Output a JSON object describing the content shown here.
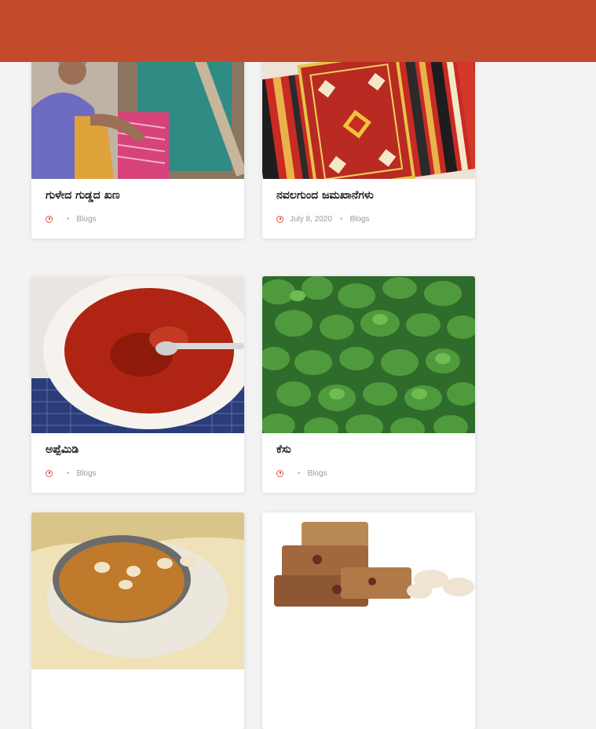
{
  "header": {
    "color": "#c44a2c"
  },
  "cards": [
    {
      "title": "ಗುಳೇದ ಗುಡ್ಡದ ಖಣ",
      "date": "",
      "category": "Blogs",
      "image": "weaver-at-handloom"
    },
    {
      "title": "ನವಲಗುಂದ ಜಮಖಾನೆಗಳು",
      "date": "July 8, 2020",
      "category": "Blogs",
      "image": "navalgund-carpet"
    },
    {
      "title": "ಅಪ್ಪೆಮಿಡಿ",
      "date": "",
      "category": "Blogs",
      "image": "mango-pickle-bowl"
    },
    {
      "title": "ಕೆಸು",
      "date": "",
      "category": "Blogs",
      "image": "colocasia-leaves"
    },
    {
      "title": "",
      "date": "",
      "category": "",
      "image": "sweet-dish-bowl"
    },
    {
      "title": "",
      "date": "",
      "category": "",
      "image": "dry-fruit-bars"
    }
  ],
  "colors": {
    "accent": "#c44a2c",
    "clock": "#e0584a"
  }
}
